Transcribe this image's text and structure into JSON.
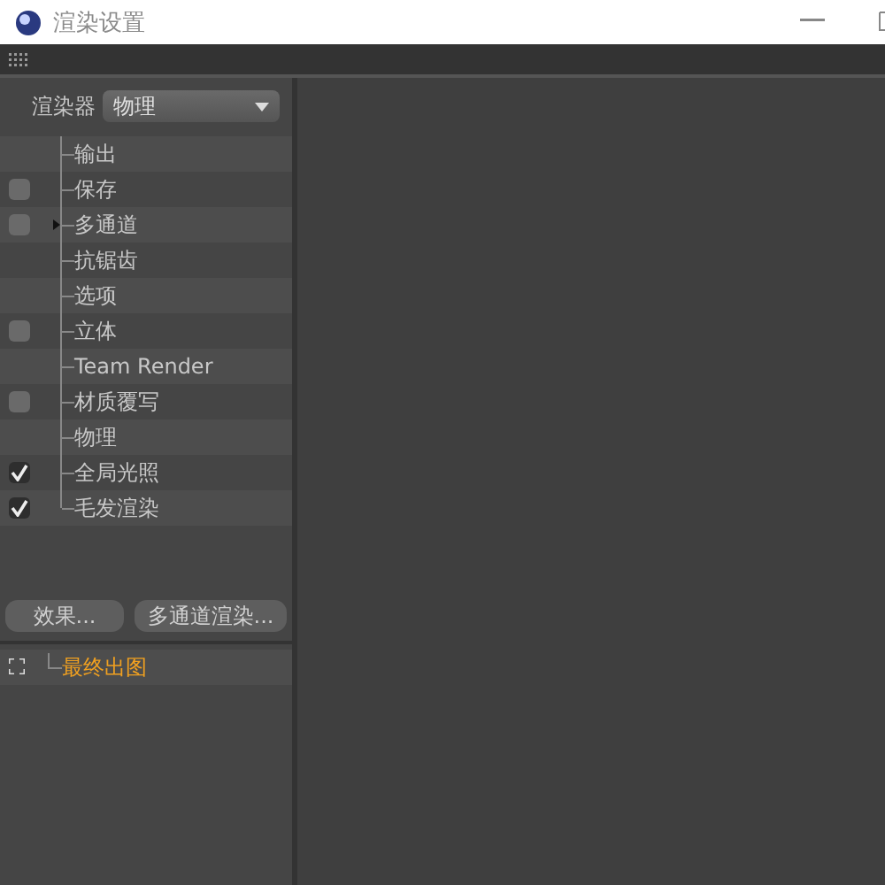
{
  "window": {
    "title": "渲染设置"
  },
  "renderer": {
    "label": "渲染器",
    "value": "物理"
  },
  "items": [
    {
      "label": "输出",
      "kind": "plain"
    },
    {
      "label": "保存",
      "kind": "checkbox",
      "checked": false
    },
    {
      "label": "多通道",
      "kind": "checkbox-group",
      "checked": false,
      "expanded": false
    },
    {
      "label": "抗锯齿",
      "kind": "plain"
    },
    {
      "label": "选项",
      "kind": "plain"
    },
    {
      "label": "立体",
      "kind": "checkbox",
      "checked": false
    },
    {
      "label": "Team Render",
      "kind": "plain"
    },
    {
      "label": "材质覆写",
      "kind": "checkbox",
      "checked": false
    },
    {
      "label": "物理",
      "kind": "plain"
    },
    {
      "label": "全局光照",
      "kind": "checkbox",
      "checked": true
    },
    {
      "label": "毛发渲染",
      "kind": "checkbox",
      "checked": true
    }
  ],
  "buttons": [
    "效果...",
    "多通道渲染..."
  ],
  "render_settings": [
    {
      "label": "最终出图",
      "selected": true
    }
  ]
}
